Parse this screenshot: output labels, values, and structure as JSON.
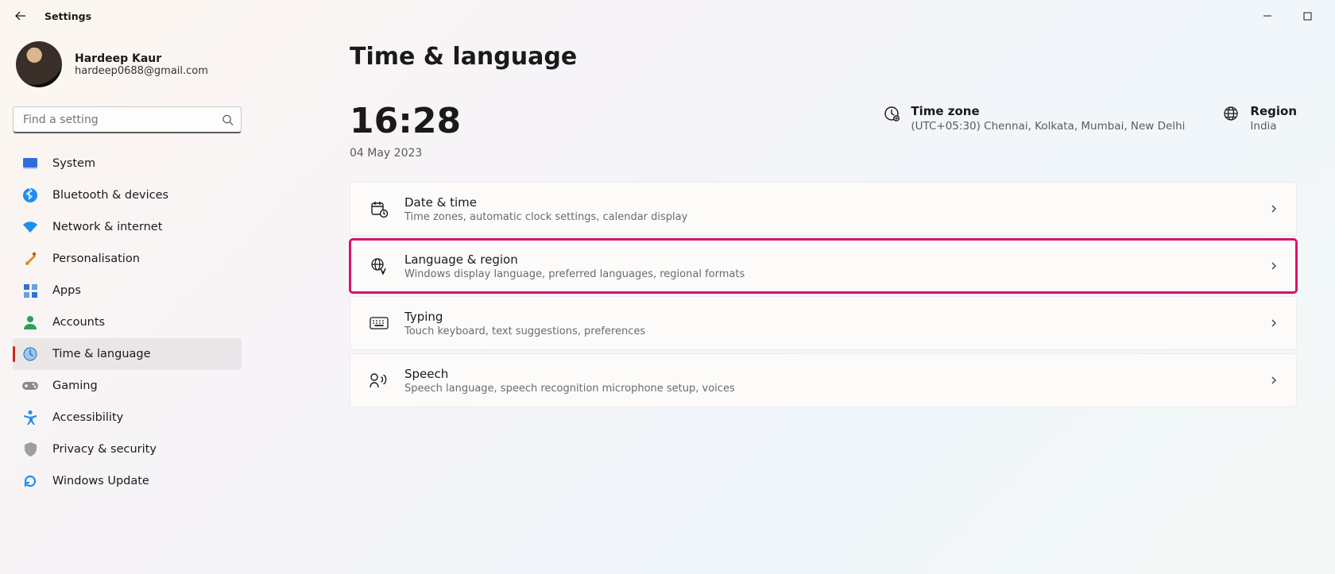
{
  "app": {
    "title": "Settings"
  },
  "profile": {
    "name": "Hardeep Kaur",
    "email": "hardeep0688@gmail.com"
  },
  "search": {
    "placeholder": "Find a setting"
  },
  "nav": {
    "items": [
      {
        "id": "system",
        "label": "System"
      },
      {
        "id": "bluetooth",
        "label": "Bluetooth & devices"
      },
      {
        "id": "network",
        "label": "Network & internet"
      },
      {
        "id": "personal",
        "label": "Personalisation"
      },
      {
        "id": "apps",
        "label": "Apps"
      },
      {
        "id": "accounts",
        "label": "Accounts"
      },
      {
        "id": "time",
        "label": "Time & language",
        "selected": true
      },
      {
        "id": "gaming",
        "label": "Gaming"
      },
      {
        "id": "access",
        "label": "Accessibility"
      },
      {
        "id": "privacy",
        "label": "Privacy & security"
      },
      {
        "id": "update",
        "label": "Windows Update"
      }
    ]
  },
  "page": {
    "title": "Time & language",
    "clock": {
      "time": "16:28",
      "date": "04 May 2023"
    },
    "timezone": {
      "title": "Time zone",
      "value": "(UTC+05:30) Chennai, Kolkata, Mumbai, New Delhi"
    },
    "region": {
      "title": "Region",
      "value": "India"
    },
    "cards": [
      {
        "id": "date-time",
        "title": "Date & time",
        "sub": "Time zones, automatic clock settings, calendar display"
      },
      {
        "id": "language-region",
        "title": "Language & region",
        "sub": "Windows display language, preferred languages, regional formats",
        "highlight": true
      },
      {
        "id": "typing",
        "title": "Typing",
        "sub": "Touch keyboard, text suggestions, preferences"
      },
      {
        "id": "speech",
        "title": "Speech",
        "sub": "Speech language, speech recognition microphone setup, voices"
      }
    ]
  }
}
